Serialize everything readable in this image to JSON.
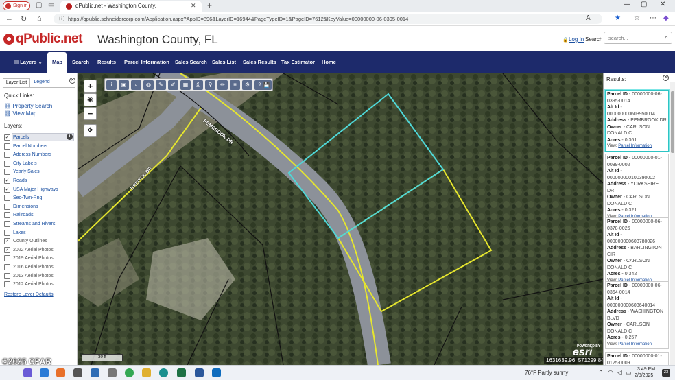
{
  "browser": {
    "signin_label": "Sign in",
    "tab_title": "qPublic.net - Washington County,",
    "url": "https://qpublic.schneidercorp.com/Application.aspx?AppID=896&LayerID=16944&PageTypeID=1&PageID=7612&KeyValue=00000000-06-0395-0014"
  },
  "site": {
    "logo": "qPublic.net",
    "county_title": "Washington County, FL",
    "login": "Log In",
    "search_label": "Search",
    "search_placeholder": "search..."
  },
  "nav": {
    "items": [
      "Layers",
      "Map",
      "Search",
      "Results",
      "Parcel Information",
      "Sales Search",
      "Sales List",
      "Sales Results",
      "Tax Estimator",
      "Home"
    ]
  },
  "left_panel": {
    "tabs": [
      "Layer List",
      "Legend"
    ],
    "quick_links_title": "Quick Links:",
    "quick_links": [
      "Property Search",
      "View Map"
    ],
    "layers_title": "Layers:",
    "layers": [
      {
        "label": "Parcels",
        "checked": true
      },
      {
        "label": "Parcel Numbers",
        "checked": false
      },
      {
        "label": "Address Numbers",
        "checked": false
      },
      {
        "label": "City Labels",
        "checked": false
      },
      {
        "label": "Yearly Sales",
        "checked": false
      },
      {
        "label": "Roads",
        "checked": true
      },
      {
        "label": "USA Major Highways",
        "checked": true
      },
      {
        "label": "Sec-Twn-Rng",
        "checked": false
      },
      {
        "label": "Dimensions",
        "checked": false
      },
      {
        "label": "Railroads",
        "checked": false
      },
      {
        "label": "Streams and Rivers",
        "checked": false
      },
      {
        "label": "Lakes",
        "checked": false
      },
      {
        "label": "County Outlines",
        "checked": true
      },
      {
        "label": "2022 Aerial Photos",
        "checked": true
      },
      {
        "label": "2019 Aerial Photos",
        "checked": false
      },
      {
        "label": "2016 Aerial Photos",
        "checked": false
      },
      {
        "label": "2013 Aerial Photos",
        "checked": false
      },
      {
        "label": "2012 Aerial Photos",
        "checked": false
      }
    ],
    "restore_label": "Restore Layer Defaults"
  },
  "map": {
    "road_label_1": "PEMBROOK DR",
    "road_label_2": "BRISTOL DR",
    "coordinates": "1631639.96, 571299.84",
    "scale": "30 ft",
    "esri_powered": "POWERED BY",
    "esri_logo": "esri",
    "colors": {
      "selected_parcel": "#4fd8d8",
      "parcel_line": "#e6e62e",
      "road": "#8c9199"
    }
  },
  "results": {
    "title": "Results:",
    "view_prefix": "View:",
    "link_label": "Parcel Information",
    "cards": [
      {
        "parcel_id": "00000000-06-0395-0014",
        "alt_id": "000000000603950014",
        "address": "PEMBROOK DR",
        "owner": "CARLSON DONALD C",
        "acres": "0.361"
      },
      {
        "parcel_id": "00000000-01-0039-0002",
        "alt_id": "000000000100390002",
        "address": "YORKSHIRE DR",
        "owner": "CARLSON DONALD C",
        "acres": "0.321"
      },
      {
        "parcel_id": "00000000-06-0378-0026",
        "alt_id": "000000000603780026",
        "address": "BARLINGTON CIR",
        "owner": "CARLSON DONALD C",
        "acres": "0.342"
      },
      {
        "parcel_id": "00000000-06-0364-0014",
        "alt_id": "000000000603640014",
        "address": "WASHINGTON BLVD",
        "owner": "CARLSON DONALD C",
        "acres": "0.257"
      },
      {
        "parcel_id": "00000000-01-0125-0009"
      }
    ],
    "labels": {
      "parcel_id": "Parcel ID",
      "alt_id": "Alt Id",
      "address": "Address",
      "owner": "Owner",
      "acres": "Acres"
    }
  },
  "watermark": "©2025 CPAR",
  "taskbar": {
    "weather": "76°F  Partly sunny",
    "time": "3:49 PM",
    "date": "2/8/2025"
  }
}
